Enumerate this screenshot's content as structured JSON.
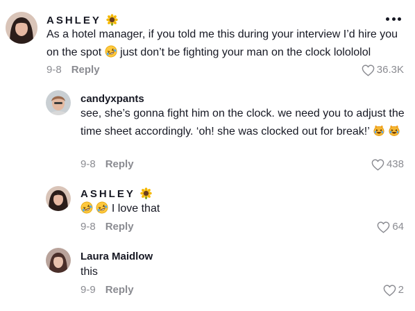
{
  "comments": [
    {
      "author": "ASHLEY",
      "text_a": "As a hotel manager, if you told me this during your interview I’d hire you on the spot",
      "text_b": "just don’t be fighting your man on the clock lolololol",
      "date": "9-8",
      "reply_label": "Reply",
      "likes": "36.3K"
    },
    {
      "author": "candyxpants",
      "text": "see, she’s gonna fight him on the clock. we need you to adjust the time sheet accordingly. ‘oh! she was clocked out for break!’",
      "date": "9-8",
      "reply_label": "Reply",
      "likes": "438"
    },
    {
      "author": "ASHLEY",
      "text": "I love that",
      "date": "9-8",
      "reply_label": "Reply",
      "likes": "64"
    },
    {
      "author": "Laura Maidlow",
      "text": "this",
      "date": "9-9",
      "reply_label": "Reply",
      "likes": "2"
    }
  ],
  "icons": {
    "author_badge": "sunflower-icon",
    "laugh": "rolling-on-floor-laughing-emoji",
    "cat": "cat-with-tears-of-joy-emoji",
    "like": "heart-outline-icon",
    "more": "more-options-icon"
  },
  "colors": {
    "text": "#161823",
    "muted": "#8a8b91"
  }
}
